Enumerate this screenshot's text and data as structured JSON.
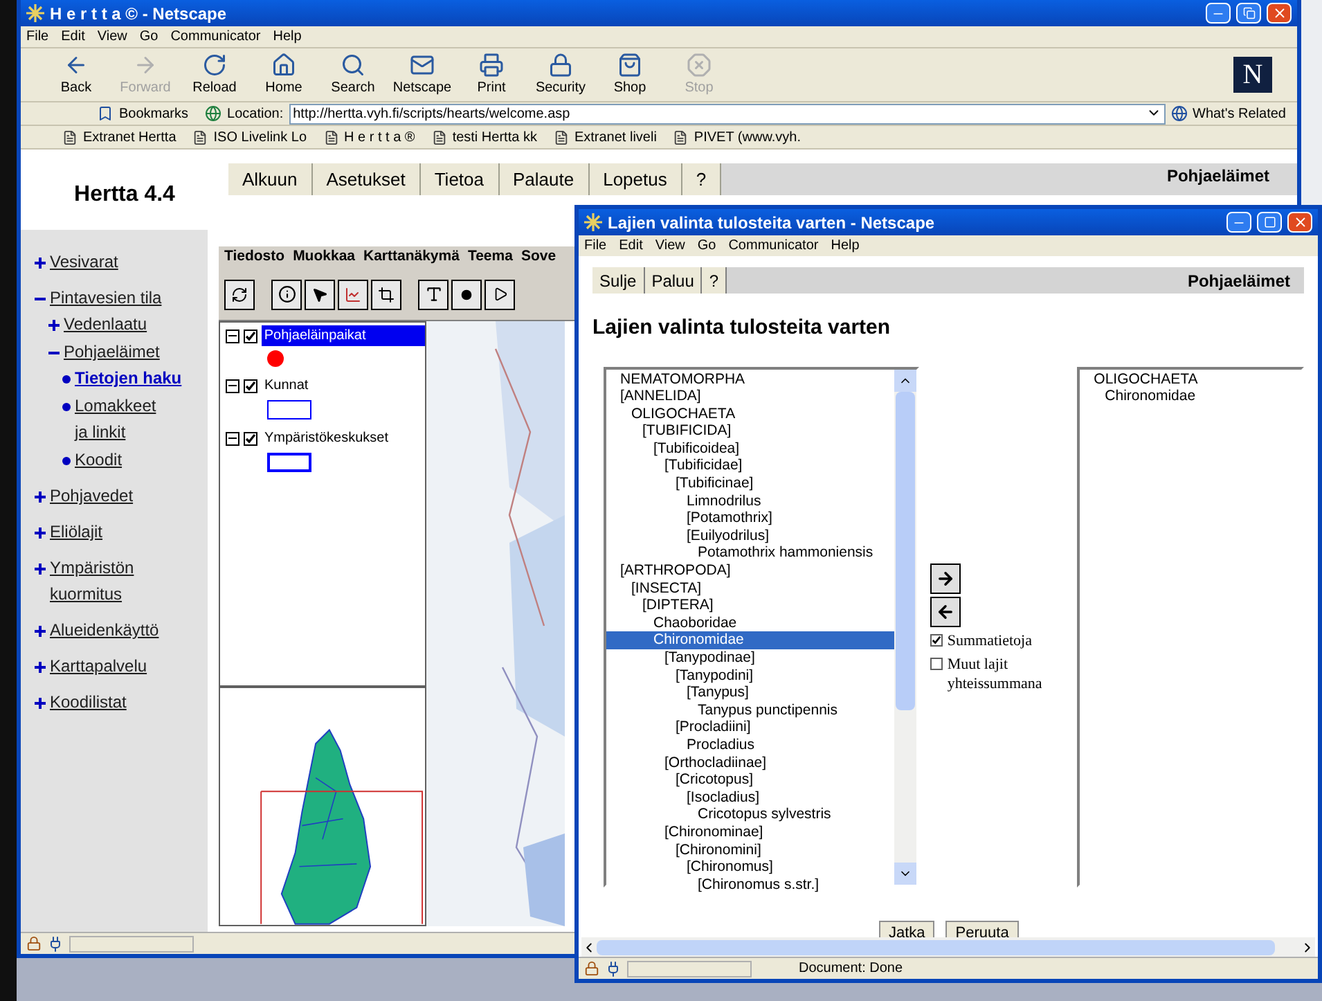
{
  "main_window": {
    "title": "H e r t t a © - Netscape",
    "menu": [
      "File",
      "Edit",
      "View",
      "Go",
      "Communicator",
      "Help"
    ],
    "toolbar": [
      {
        "label": "Back",
        "disabled": false
      },
      {
        "label": "Forward",
        "disabled": true
      },
      {
        "label": "Reload",
        "disabled": false
      },
      {
        "label": "Home",
        "disabled": false
      },
      {
        "label": "Search",
        "disabled": false
      },
      {
        "label": "Netscape",
        "disabled": false
      },
      {
        "label": "Print",
        "disabled": false
      },
      {
        "label": "Security",
        "disabled": false
      },
      {
        "label": "Shop",
        "disabled": false
      },
      {
        "label": "Stop",
        "disabled": true
      }
    ],
    "logo": "N",
    "location_bar": {
      "bookmarks": "Bookmarks",
      "label": "Location:",
      "value": "http://hertta.vyh.fi/scripts/hearts/welcome.asp",
      "related": "What's Related"
    },
    "personal_toolbar": [
      "Extranet Hertta",
      "ISO Livelink Lo",
      "H e r t t a ®",
      "testi Hertta kk",
      "Extranet liveli",
      "PIVET (www.vyh."
    ]
  },
  "page": {
    "app_title": "Hertta 4.4",
    "nav_tabs": [
      "Alkuun",
      "Asetukset",
      "Tietoa",
      "Palaute",
      "Lopetus",
      "?"
    ],
    "section": "Pohjaeläimet",
    "sidebar": [
      {
        "label": "Vesivarat",
        "expanded": false
      },
      {
        "label": "Pintavesien tila",
        "expanded": true,
        "children": [
          {
            "label": "Vedenlaatu",
            "expanded": false
          },
          {
            "label": "Pohjaeläimet",
            "expanded": true,
            "children": [
              {
                "label": "Tietojen haku",
                "selected": true
              },
              {
                "label": "Lomakkeet ja linkit",
                "selected": false
              },
              {
                "label": "Koodit",
                "selected": false
              }
            ]
          }
        ]
      },
      {
        "label": "Pohjavedet",
        "expanded": false
      },
      {
        "label": "Eliölajit",
        "expanded": false
      },
      {
        "label": "Ympäristön kuormitus",
        "expanded": false
      },
      {
        "label": "Alueidenkäyttö",
        "expanded": false
      },
      {
        "label": "Karttapalvelu",
        "expanded": false
      },
      {
        "label": "Koodilistat",
        "expanded": false
      }
    ],
    "map_app": {
      "menu": [
        "Tiedosto",
        "Muokkaa",
        "Karttanäkymä",
        "Teema",
        "Sove"
      ],
      "layers": [
        {
          "name": "Pohjaeläinpaikat",
          "checked": true,
          "selected": true,
          "kind": "dot",
          "color": "#ff0000"
        },
        {
          "name": "Kunnat",
          "checked": true,
          "selected": false,
          "kind": "thin-box",
          "color": "#0000ff"
        },
        {
          "name": "Ympäristökeskukset",
          "checked": true,
          "selected": false,
          "kind": "thick-box",
          "color": "#0000ff"
        }
      ]
    }
  },
  "popup": {
    "title": "Lajien valinta tulosteita varten - Netscape",
    "menu": [
      "File",
      "Edit",
      "View",
      "Go",
      "Communicator",
      "Help"
    ],
    "buttons": [
      "Sulje",
      "Paluu",
      "?"
    ],
    "section": "Pohjaeläimet",
    "heading": "Lajien valinta tulosteita varten",
    "available": [
      {
        "label": "NEMATOMORPHA",
        "selected": false
      },
      {
        "label": "[ANNELIDA]",
        "selected": false,
        "children": [
          {
            "label": "OLIGOCHAETA",
            "selected": false,
            "children": [
              {
                "label": "[TUBIFICIDA]",
                "selected": false,
                "children": [
                  {
                    "label": "[Tubificoidea]",
                    "selected": false,
                    "children": [
                      {
                        "label": "[Tubificidae]",
                        "selected": false,
                        "children": [
                          {
                            "label": "[Tubificinae]",
                            "selected": false,
                            "children": [
                              {
                                "label": "Limnodrilus",
                                "selected": false
                              },
                              {
                                "label": "[Potamothrix]",
                                "selected": false
                              },
                              {
                                "label": "[Euilyodrilus]",
                                "selected": false,
                                "children": [
                                  {
                                    "label": "Potamothrix hammoniensis",
                                    "selected": false
                                  }
                                ]
                              }
                            ]
                          }
                        ]
                      }
                    ]
                  }
                ]
              }
            ]
          }
        ]
      },
      {
        "label": "[ARTHROPODA]",
        "selected": false,
        "children": [
          {
            "label": "[INSECTA]",
            "selected": false,
            "children": [
              {
                "label": "[DIPTERA]",
                "selected": false,
                "children": [
                  {
                    "label": "Chaoboridae",
                    "selected": false
                  },
                  {
                    "label": "Chironomidae",
                    "selected": true,
                    "children": [
                      {
                        "label": "[Tanypodinae]",
                        "selected": false,
                        "children": [
                          {
                            "label": "[Tanypodini]",
                            "selected": false,
                            "children": [
                              {
                                "label": "[Tanypus]",
                                "selected": false,
                                "children": [
                                  {
                                    "label": "Tanypus punctipennis",
                                    "selected": false
                                  }
                                ]
                              }
                            ]
                          },
                          {
                            "label": "[Procladiini]",
                            "selected": false,
                            "children": [
                              {
                                "label": "Procladius",
                                "selected": false
                              }
                            ]
                          }
                        ]
                      },
                      {
                        "label": "[Orthocladiinae]",
                        "selected": false,
                        "children": [
                          {
                            "label": "[Cricotopus]",
                            "selected": false,
                            "children": [
                              {
                                "label": "[Isocladius]",
                                "selected": false,
                                "children": [
                                  {
                                    "label": "Cricotopus sylvestris",
                                    "selected": false
                                  }
                                ]
                              }
                            ]
                          }
                        ]
                      },
                      {
                        "label": "[Chironominae]",
                        "selected": false,
                        "children": [
                          {
                            "label": "[Chironomini]",
                            "selected": false,
                            "children": [
                              {
                                "label": "[Chironomus]",
                                "selected": false,
                                "children": [
                                  {
                                    "label": "[Chironomus s.str.]",
                                    "selected": false
                                  }
                                ]
                              }
                            ]
                          }
                        ]
                      }
                    ]
                  }
                ]
              }
            ]
          }
        ]
      }
    ],
    "chosen": [
      {
        "label": "OLIGOCHAETA",
        "selected": false,
        "children": [
          {
            "label": "Chironomidae",
            "selected": false
          }
        ]
      }
    ],
    "options": [
      {
        "label": "Summatietoja",
        "checked": true
      },
      {
        "label": "Muut lajit yhteissummana",
        "checked": false
      }
    ],
    "actions": [
      "Jatka",
      "Peruuta"
    ],
    "status": "Document: Done"
  }
}
